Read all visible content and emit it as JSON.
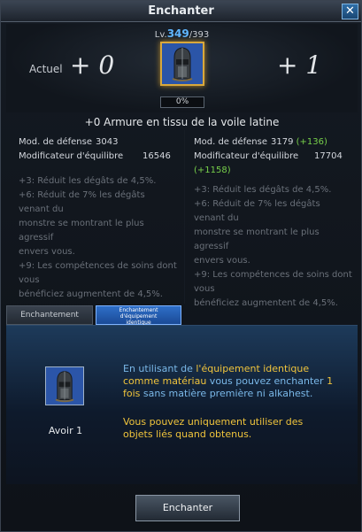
{
  "window": {
    "title": "Enchanter",
    "close_label": "✕"
  },
  "header": {
    "level_prefix": "Lv.",
    "level_current": "349",
    "level_max": "/393",
    "actuel_label": "Actuel",
    "current_enchant": "+ 0",
    "next_enchant": "+ 1",
    "progress": "0%",
    "progress_fraction": 0
  },
  "item": {
    "name": "+0 Armure en tissu de la voile latine",
    "icon": "helmet-icon"
  },
  "current_stats": {
    "defense_label": "Mod. de défense",
    "defense_value": "3043",
    "balance_label": "Modificateur d'équilibre",
    "balance_value": "16546"
  },
  "next_stats": {
    "defense_label": "Mod. de défense",
    "defense_value": "3179",
    "defense_bonus": "(+136)",
    "balance_label": "Modificateur d'équilibre",
    "balance_value": "17704",
    "balance_bonus": "(+1158)"
  },
  "bonuses": [
    "+3: Réduit les dégâts de 4,5%.",
    "+6: Réduit de 7% les dégâts venant du",
    "monstre se montrant le plus agressif",
    "envers vous.",
    "+9: Les compétences de soins dont vous",
    "bénéficiez augmentent de 4,5%."
  ],
  "tabs": {
    "normal": "Enchantement normal",
    "identical": [
      "Enchantement",
      "d'équipement",
      "identique"
    ]
  },
  "material": {
    "have_label": "Avoir 1"
  },
  "description": {
    "p1_a": "En utilisant de ",
    "p1_b": "l'équipement identique comme matériau",
    "p1_c": " vous pouvez enchanter ",
    "p1_d": "1 fois",
    "p1_e": " sans matière première ni alkahest.",
    "p2": "Vous pouvez uniquement utiliser des objets liés quand obtenus."
  },
  "button": {
    "enchant": "Enchanter"
  },
  "colors": {
    "accent": "#5fb6ff",
    "bonus_green": "#77d04a",
    "highlight": "#f0c43c",
    "info_blue": "#7ab8e8"
  }
}
